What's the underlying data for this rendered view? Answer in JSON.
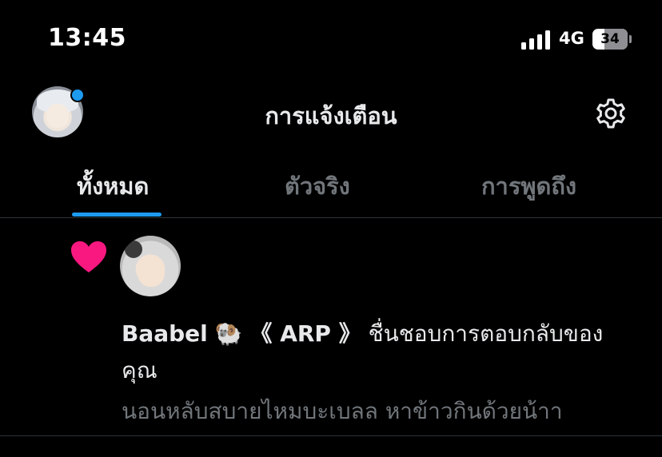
{
  "status_bar": {
    "time": "13:45",
    "network": "4G",
    "battery": "34"
  },
  "header": {
    "title": "การแจ้งเตือน"
  },
  "tabs": [
    {
      "label": "ทั้งหมด"
    },
    {
      "label": "ตัวจริง"
    },
    {
      "label": "การพูดถึง"
    }
  ],
  "notification": {
    "user_name": "Baabel",
    "emoji": "🐏",
    "tag": "《 ARP 》",
    "action": "ชื่นชอบการตอบกลับของคุณ",
    "reply_text": "นอนหลับสบายไหมบะเบลล หาข้าวกินด้วยน้าา"
  },
  "colors": {
    "accent": "#1d9bf0",
    "like": "#f91880",
    "muted": "#71767b"
  }
}
